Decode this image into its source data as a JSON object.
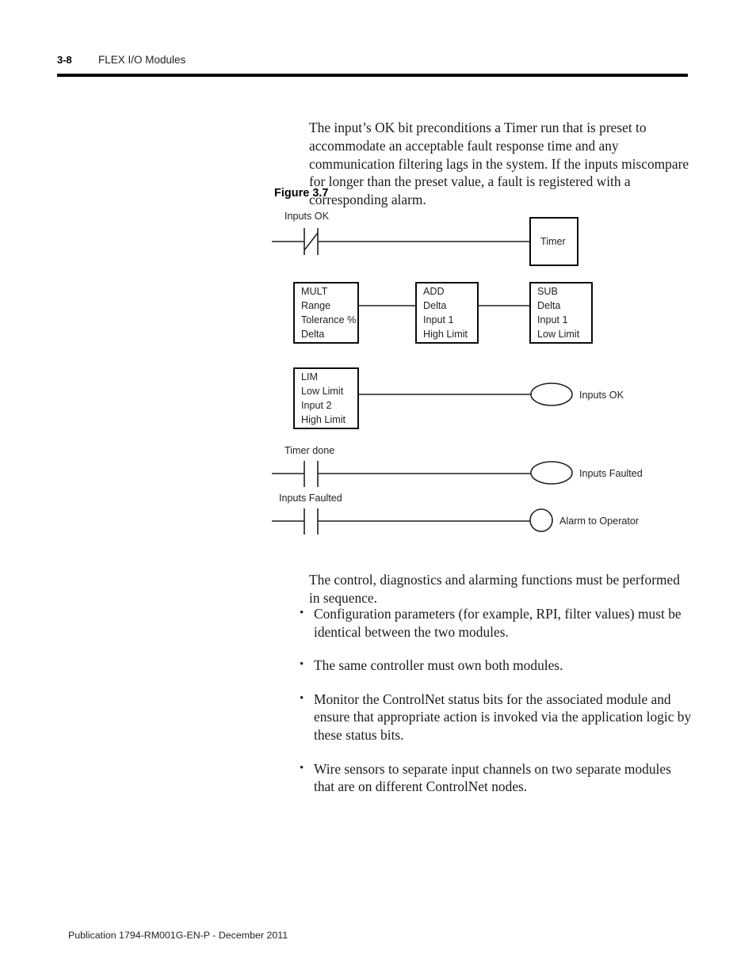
{
  "header": {
    "page_number": "3-8",
    "title": "FLEX I/O Modules"
  },
  "intro_paragraph": "The input’s OK bit preconditions a Timer run that is preset to accommodate an acceptable fault response time and any communication filtering lags in the system. If the inputs miscompare for longer than the preset value, a fault is registered with a corresponding alarm.",
  "figure": {
    "caption": "Figure 3.7",
    "rungs": {
      "rung1_contact_label": "Inputs OK",
      "rung1_output_box": "Timer",
      "rung4_contact_label": "Timer done",
      "rung4_coil_label": "Inputs Faulted",
      "rung5_contact_label": "Inputs Faulted",
      "rung5_coil_label": "Alarm to Operator"
    },
    "blocks": {
      "mult": {
        "name": "MULT",
        "line1": "Range",
        "line2": "Tolerance %",
        "line3": "Delta"
      },
      "add": {
        "name": "ADD",
        "line1": "Delta",
        "line2": "Input 1",
        "line3": "High Limit"
      },
      "sub": {
        "name": "SUB",
        "line1": "Delta",
        "line2": "Input 1",
        "line3": "Low Limit"
      },
      "lim": {
        "name": "LIM",
        "line1": "Low Limit",
        "line2": "Input 2",
        "line3": "High Limit",
        "coil_label": "Inputs OK"
      }
    }
  },
  "sequence_paragraph": "The control, diagnostics and alarming functions must be performed in sequence.",
  "bullets": [
    "Configuration parameters (for example, RPI, filter values) must be identical between the two modules.",
    "The same controller must own both modules.",
    "Monitor the ControlNet status bits for the associated module and ensure that appropriate action is invoked via the application logic by these status bits.",
    "Wire sensors to separate input channels on two separate modules that are on different ControlNet nodes."
  ],
  "footer": "Publication 1794-RM001G-EN-P - December 2011"
}
